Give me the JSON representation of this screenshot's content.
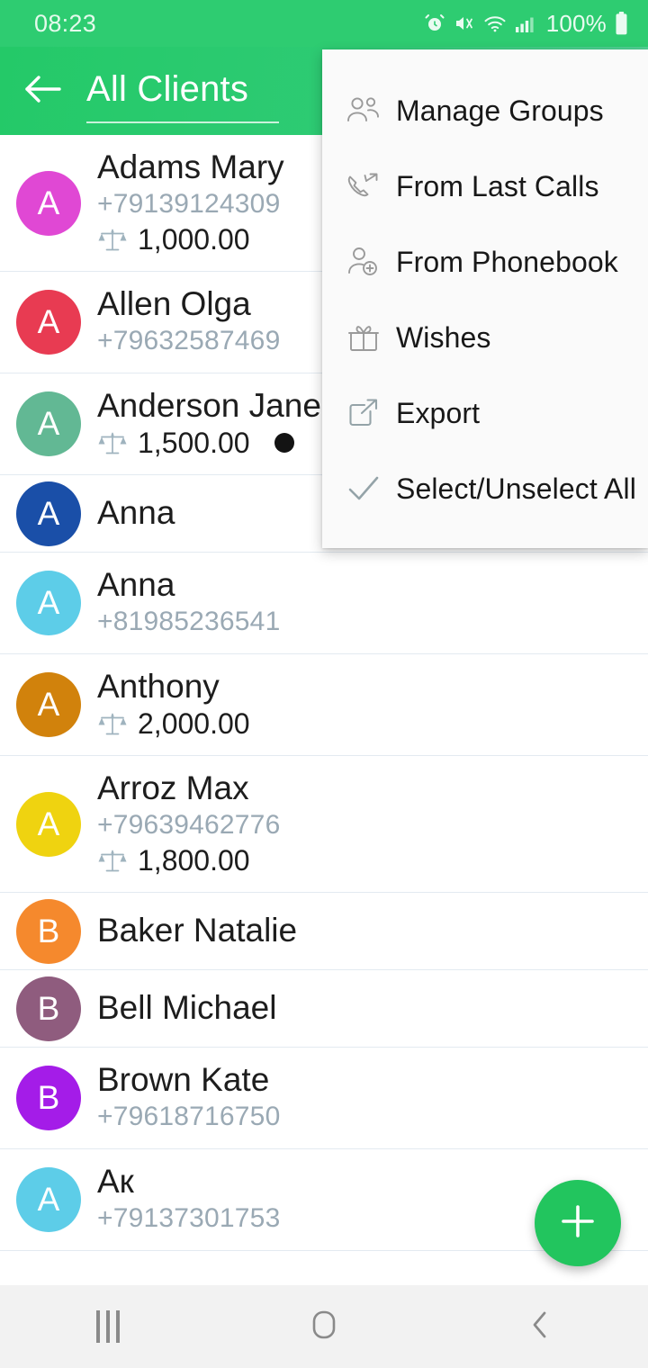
{
  "status_bar": {
    "time": "08:23",
    "battery_percent": "100%",
    "icons": [
      "alarm-icon",
      "mute-vibrate-icon",
      "wifi-icon",
      "signal-icon",
      "battery-icon"
    ]
  },
  "app_bar": {
    "back_icon": "arrow-left-icon",
    "title": "All Clients",
    "accent_color": "#2ECC71"
  },
  "menu": {
    "items": [
      {
        "label": "Manage Groups",
        "icon": "group-people-icon"
      },
      {
        "label": "From Last Calls",
        "icon": "call-arrow-icon"
      },
      {
        "label": "From Phonebook",
        "icon": "person-add-icon"
      },
      {
        "label": "Wishes",
        "icon": "gift-icon"
      },
      {
        "label": "Export",
        "icon": "export-icon"
      },
      {
        "label": "Select/Unselect All",
        "icon": "check-icon"
      }
    ]
  },
  "contacts": [
    {
      "initial": "A",
      "color": "#E048D4",
      "name": "Adams Mary",
      "phone": "+79139124309",
      "balance": "1,000.00",
      "marked": false
    },
    {
      "initial": "A",
      "color": "#E83B52",
      "name": "Allen Olga",
      "phone": "+79632587469",
      "balance": "",
      "marked": false
    },
    {
      "initial": "A",
      "color": "#62B894",
      "name": "Anderson Jane",
      "phone": "",
      "balance": "1,500.00",
      "marked": true
    },
    {
      "initial": "A",
      "color": "#1A4FA8",
      "name": "Anna",
      "phone": "",
      "balance": "",
      "marked": false
    },
    {
      "initial": "A",
      "color": "#5DCDE8",
      "name": "Anna",
      "phone": "+81985236541",
      "balance": "",
      "marked": false
    },
    {
      "initial": "A",
      "color": "#D1820C",
      "name": "Anthony",
      "phone": "",
      "balance": "2,000.00",
      "marked": false
    },
    {
      "initial": "A",
      "color": "#EFD310",
      "name": "Arroz Max",
      "phone": "+79639462776",
      "balance": "1,800.00",
      "marked": false
    },
    {
      "initial": "B",
      "color": "#F5892D",
      "name": "Baker Natalie",
      "phone": "",
      "balance": "",
      "marked": false
    },
    {
      "initial": "B",
      "color": "#8F5C7E",
      "name": "Bell Michael",
      "phone": "",
      "balance": "",
      "marked": false
    },
    {
      "initial": "B",
      "color": "#A41CE8",
      "name": "Brown Kate",
      "phone": "+79618716750",
      "balance": "",
      "marked": false
    },
    {
      "initial": "A",
      "color": "#5DCDE8",
      "name": "Ак",
      "phone": "+79137301753",
      "balance": "",
      "marked": false
    }
  ],
  "fab": {
    "icon": "plus-icon",
    "color": "#22C55E"
  },
  "nav_bar": {
    "recents": "recents-icon",
    "home": "home-icon",
    "back": "back-icon"
  }
}
